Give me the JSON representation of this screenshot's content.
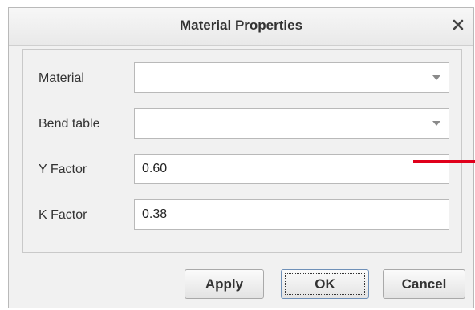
{
  "dialog": {
    "title": "Material Properties",
    "close_icon": "close-icon",
    "close_glyph": "✕"
  },
  "fields": {
    "material": {
      "label": "Material",
      "value": "",
      "arrow_icon": "chevron-down-icon"
    },
    "bend_table": {
      "label": "Bend table",
      "value": "",
      "arrow_icon": "chevron-down-icon"
    },
    "y_factor": {
      "label": "Y Factor",
      "value": "0.60"
    },
    "k_factor": {
      "label": "K Factor",
      "value": "0.38"
    }
  },
  "buttons": {
    "apply": "Apply",
    "ok": "OK",
    "cancel": "Cancel"
  },
  "colors": {
    "annotation_line": "#e0001b",
    "default_button_border": "#6f90b8"
  }
}
